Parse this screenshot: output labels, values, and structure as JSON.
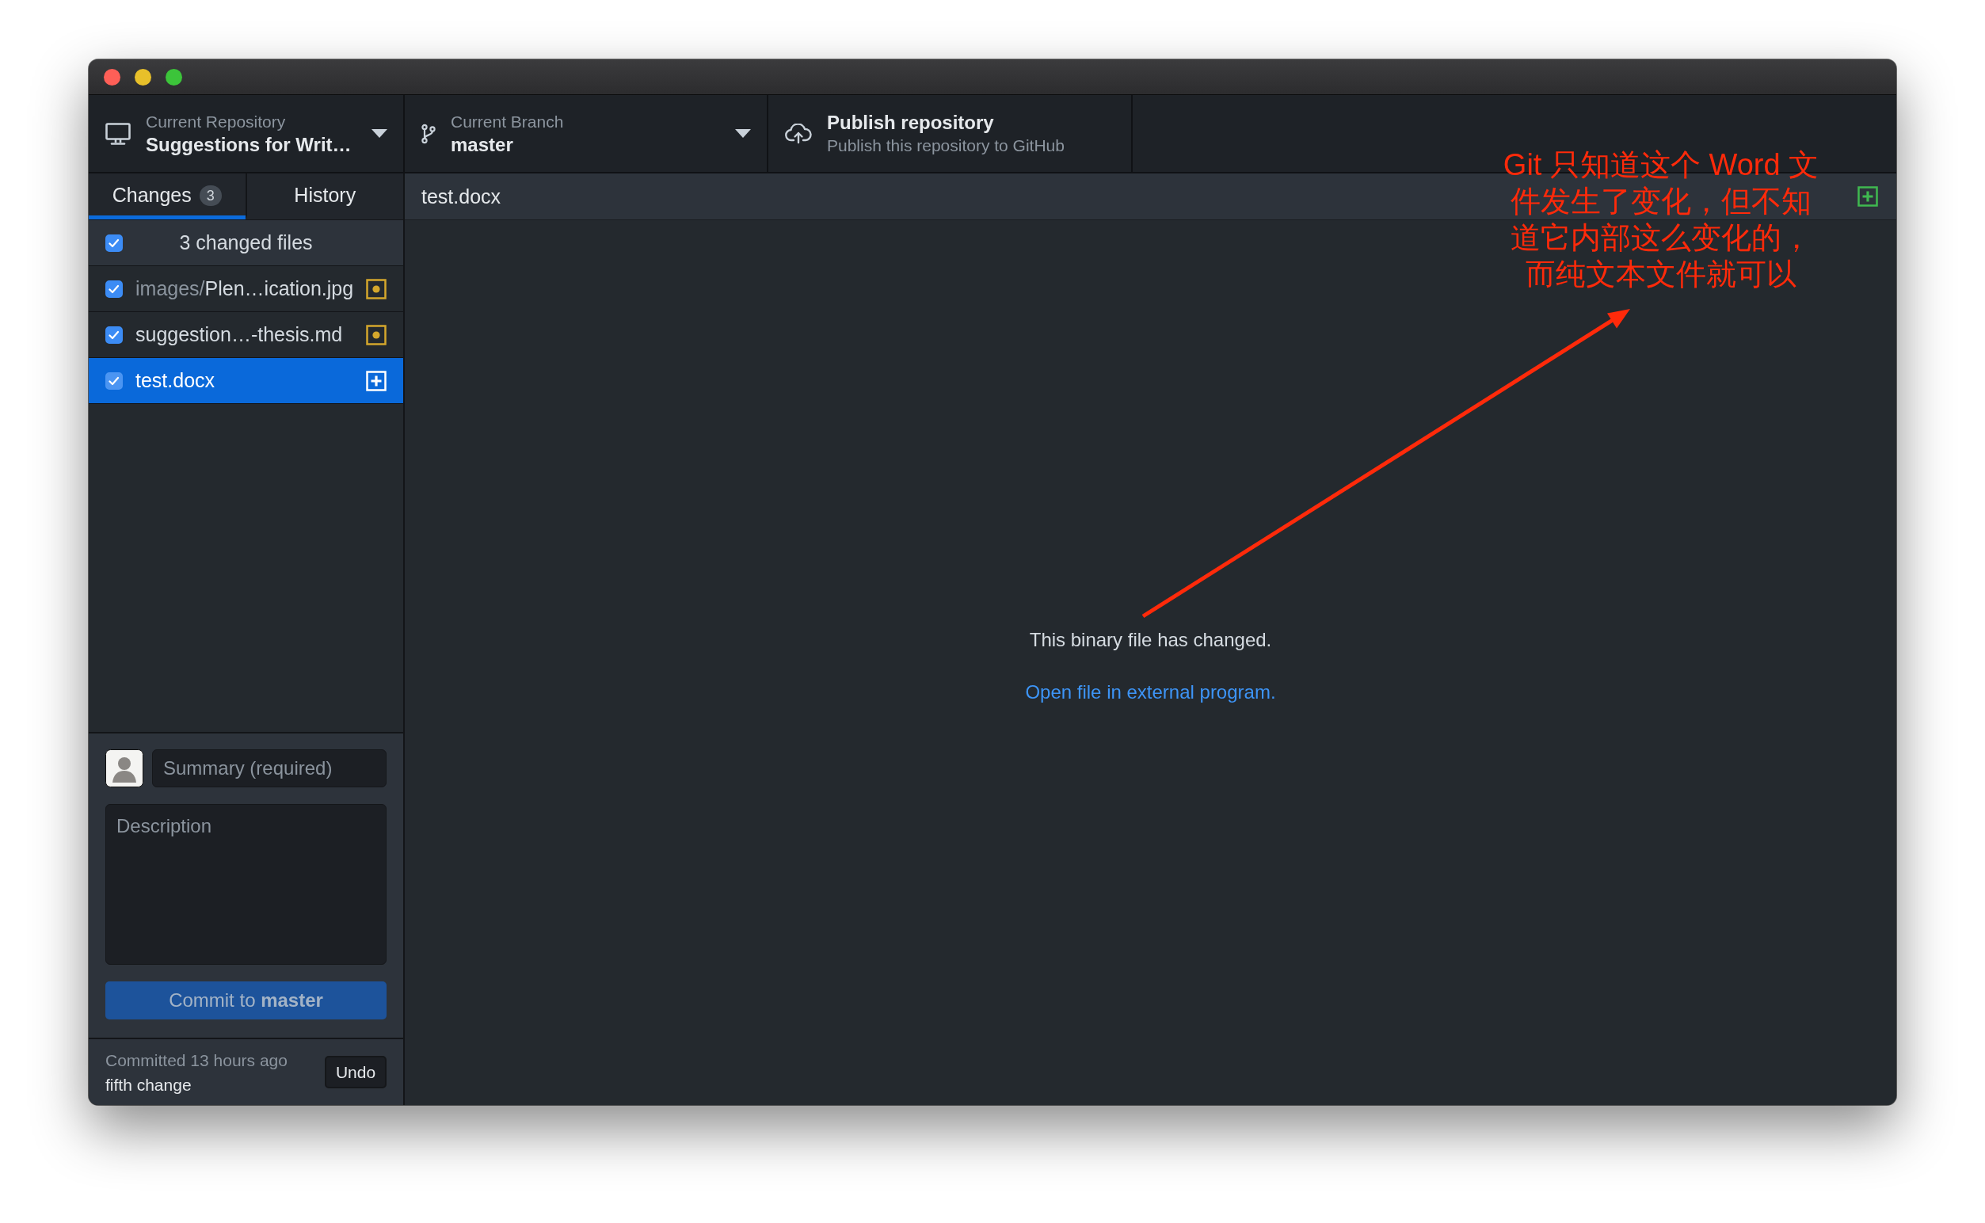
{
  "toolbar": {
    "repository": {
      "label": "Current Repository",
      "value": "Suggestions for Writ…"
    },
    "branch": {
      "label": "Current Branch",
      "value": "master"
    },
    "publish": {
      "title": "Publish repository",
      "subtitle": "Publish this repository to GitHub"
    }
  },
  "tabs": [
    {
      "label": "Changes",
      "count": "3",
      "selected": true
    },
    {
      "label": "History",
      "selected": false
    }
  ],
  "changes": {
    "header": {
      "label": "3 changed files",
      "checked": true
    },
    "files": [
      {
        "directory": "images/",
        "name": "Plen…ication.jpg",
        "kind": "modified",
        "checked": true,
        "selected": false
      },
      {
        "name": "suggestion…-thesis.md",
        "kind": "modified",
        "checked": true,
        "selected": false
      },
      {
        "name": "test.docx",
        "kind": "added",
        "checked": true,
        "selected": true
      }
    ]
  },
  "commit": {
    "summary": {
      "placeholder": "Summary (required)"
    },
    "description": {
      "placeholder": "Description"
    },
    "button": {
      "label": "Commit to **master**",
      "disabled": true
    }
  },
  "last_commit": {
    "time": "Committed 13 hours ago",
    "message": "fifth change",
    "undo": "Undo"
  },
  "diff": {
    "file": {
      "name": "test.docx",
      "kind": "added"
    },
    "message": "This binary file has changed.",
    "link": "Open file in external program."
  },
  "annotation": {
    "lines": [
      "Git 只知道这个 Word 文",
      "件发生了变化，但不知",
      "道它内部这么变化的，",
      "而纯文本文件就可以"
    ]
  }
}
